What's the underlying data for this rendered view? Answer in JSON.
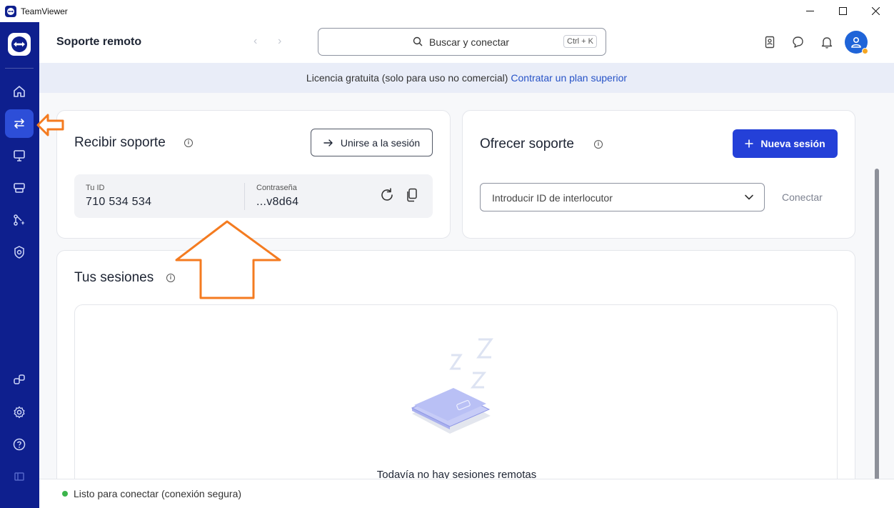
{
  "window": {
    "title": "TeamViewer"
  },
  "header": {
    "page_title": "Soporte remoto",
    "search_text": "Buscar y conectar",
    "search_shortcut": "Ctrl + K"
  },
  "license": {
    "text": "Licencia gratuita (solo para uso no comercial)",
    "link": "Contratar un plan superior"
  },
  "receive": {
    "title": "Recibir soporte",
    "join_button": "Unirse a la sesión",
    "id_label": "Tu ID",
    "id_value": "710 534 534",
    "password_label": "Contraseña",
    "password_value": "...v8d64"
  },
  "offer": {
    "title": "Ofrecer soporte",
    "new_session_button": "Nueva sesión",
    "partner_placeholder": "Introducir ID de interlocutor",
    "connect_button": "Conectar"
  },
  "sessions": {
    "title": "Tus sesiones",
    "empty_text": "Todavía no hay sesiones remotas"
  },
  "status": {
    "text": "Listo para conectar (conexión segura)"
  },
  "colors": {
    "nav_bg": "#0e1f8e",
    "nav_active": "#2d4ed8",
    "primary": "#2440d8",
    "annotation": "#f47b20"
  }
}
